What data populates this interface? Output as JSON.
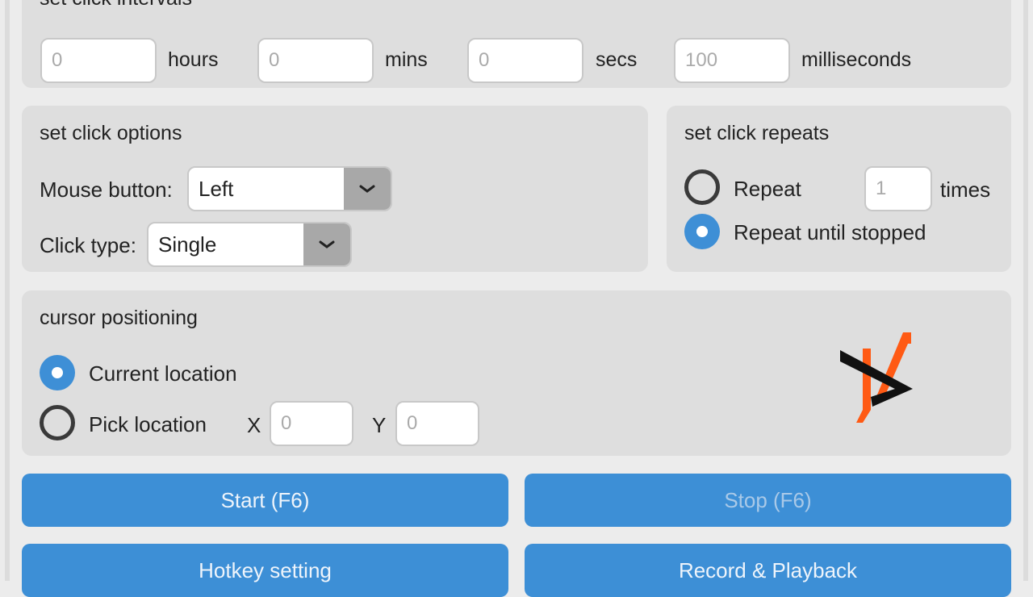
{
  "intervals": {
    "title": "set click intervals",
    "hours": {
      "value": "0",
      "label": "hours"
    },
    "mins": {
      "value": "0",
      "label": "mins"
    },
    "secs": {
      "value": "0",
      "label": "secs"
    },
    "milliseconds": {
      "value": "100",
      "label": "milliseconds"
    }
  },
  "options": {
    "title": "set click options",
    "mouse_button_label": "Mouse button:",
    "mouse_button_value": "Left",
    "click_type_label": "Click type:",
    "click_type_value": "Single"
  },
  "repeats": {
    "title": "set click repeats",
    "repeat_label": "Repeat",
    "repeat_count": "1",
    "times_label": "times",
    "repeat_until_stopped_label": "Repeat until stopped",
    "selected": "repeat_until_stopped"
  },
  "cursor": {
    "title": "cursor positioning",
    "current_location_label": "Current location",
    "pick_location_label": "Pick location",
    "x_label": "X",
    "x_value": "0",
    "y_label": "Y",
    "y_value": "0",
    "selected": "current_location"
  },
  "buttons": {
    "start": "Start (F6)",
    "stop": "Stop (F6)",
    "hotkey": "Hotkey setting",
    "record": "Record & Playback"
  },
  "colors": {
    "accent": "#3d8fd6",
    "logo_orange": "#ff5a14",
    "logo_black": "#111111"
  },
  "icons": {
    "dropdown": "chevron-down-icon",
    "logo": "app-logo"
  }
}
